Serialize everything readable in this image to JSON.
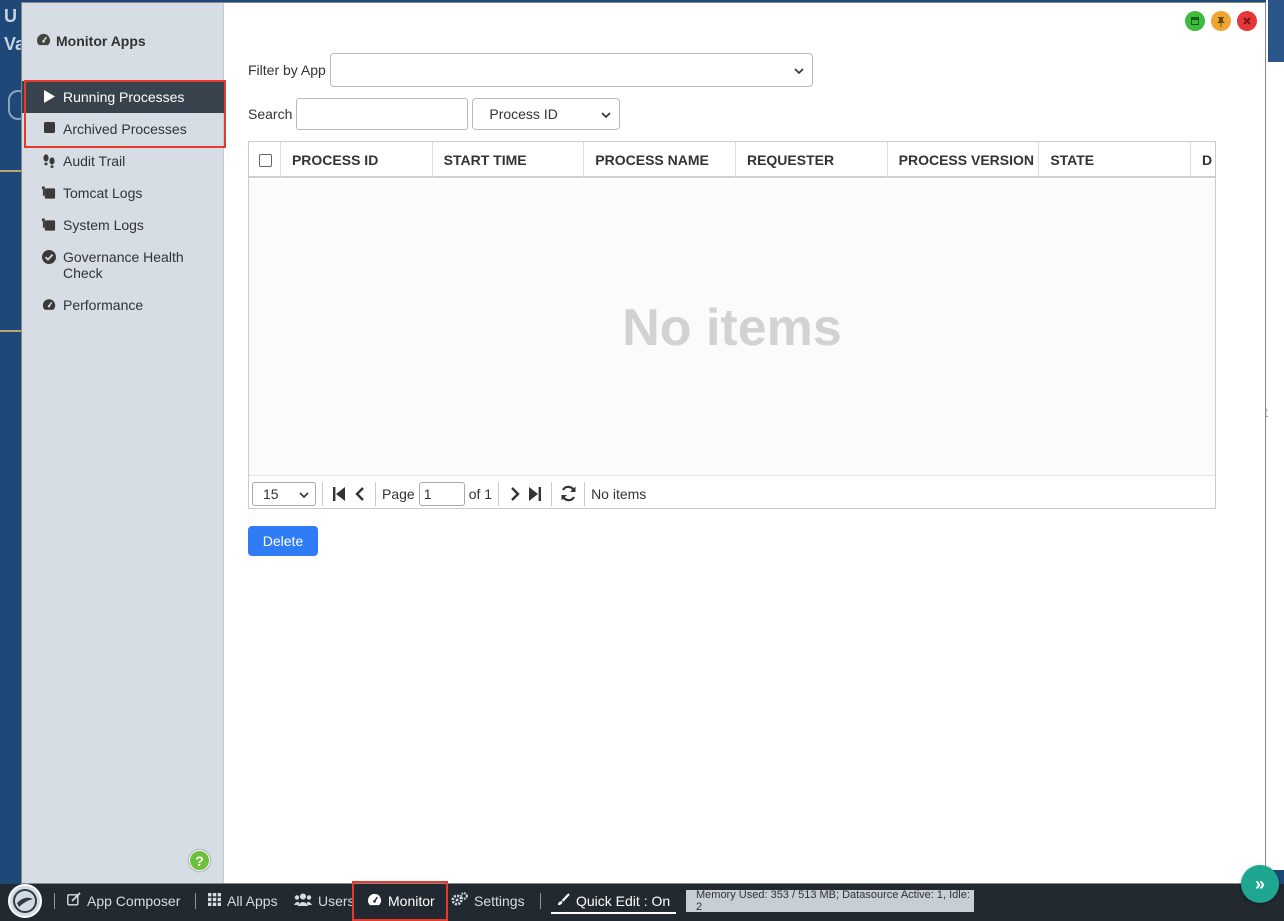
{
  "background": {
    "char_top": "U",
    "char_second": "Va",
    "char_right": "t"
  },
  "window": {
    "controls": {
      "minimize_icon": "minimize-icon",
      "pin_icon": "pin-icon",
      "close_icon": "close-icon",
      "minimize_color": "#3dbb3d",
      "pin_color": "#f0a531",
      "close_color": "#e4383b"
    }
  },
  "sidebar": {
    "title": "Monitor Apps",
    "items": [
      {
        "label": "Running Processes",
        "icon": "play-icon",
        "active": true
      },
      {
        "label": "Archived Processes",
        "icon": "stop-icon",
        "active": false
      },
      {
        "label": "Audit Trail",
        "icon": "footprints-icon",
        "active": false
      },
      {
        "label": "Tomcat Logs",
        "icon": "logs-icon",
        "active": false
      },
      {
        "label": "System Logs",
        "icon": "logs-icon",
        "active": false
      },
      {
        "label": "Governance Health Check",
        "icon": "check-circle-icon",
        "active": false
      },
      {
        "label": "Performance",
        "icon": "dashboard-icon",
        "active": false
      }
    ],
    "help_label": "?"
  },
  "filters": {
    "filter_label": "Filter by App",
    "filter_value": "",
    "search_label": "Search",
    "search_value": "",
    "search_field_select": "Process ID"
  },
  "grid": {
    "columns": [
      "PROCESS ID",
      "START TIME",
      "PROCESS NAME",
      "REQUESTER",
      "PROCESS VERSION",
      "STATE",
      "D"
    ],
    "empty_message": "No items",
    "pager": {
      "page_size": "15",
      "page_label": "Page",
      "page_value": "1",
      "of_label": "of 1",
      "status": "No items"
    }
  },
  "actions": {
    "delete_label": "Delete"
  },
  "taskbar": {
    "items": [
      {
        "label": "App Composer",
        "icon": "edit-icon"
      },
      {
        "label": "All Apps",
        "icon": "grid-icon"
      },
      {
        "label": "Users",
        "icon": "users-icon"
      },
      {
        "label": "Monitor",
        "icon": "dashboard-icon"
      },
      {
        "label": "Settings",
        "icon": "gears-icon"
      },
      {
        "label": "Quick Edit : On",
        "icon": "brush-icon"
      }
    ],
    "memory_status": "Memory Used: 353 / 513 MB; Datasource Active: 1, Idle: 2",
    "expand_label": "»"
  },
  "colors": {
    "accent": "#2f7cf6",
    "highlight": "#e8392d",
    "sidebar_active": "#38434e"
  }
}
